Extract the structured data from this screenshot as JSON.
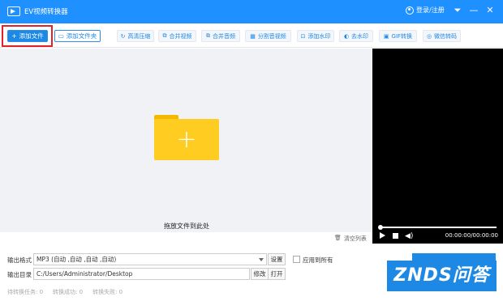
{
  "app": {
    "title": "EV视频转换器",
    "user_label": "登录/注册"
  },
  "window": {
    "menu": "⏷",
    "minimize": "—",
    "close": "✕"
  },
  "toolbar": {
    "add_file": "添加文件",
    "add_folder": "添加文件夹",
    "tools": [
      {
        "label": "高清压缩",
        "icon": "↻"
      },
      {
        "label": "合并视频",
        "icon": "⧉"
      },
      {
        "label": "合并音频",
        "icon": "⧉"
      },
      {
        "label": "分割音视频",
        "icon": "▦"
      },
      {
        "label": "添加水印",
        "icon": "⊡"
      },
      {
        "label": "去水印",
        "icon": "◐"
      },
      {
        "label": "GIF转换",
        "icon": "▣"
      },
      {
        "label": "微信转码",
        "icon": "◎"
      }
    ]
  },
  "dropzone": {
    "text": "拖放文件到此处"
  },
  "player": {
    "time": "00:00:00/00:00:00"
  },
  "list": {
    "clear_label": "清空列表"
  },
  "output": {
    "format_label": "输出格式",
    "format_value": "MP3 (自动 ,自动 ,自动 ,自动)",
    "settings_label": "设置",
    "apply_all_label": "应用到所有",
    "dir_label": "输出目录",
    "dir_value": "C:/Users/Administrator/Desktop",
    "modify_label": "修改",
    "open_label": "打开"
  },
  "stats": {
    "waiting": "待转换任务: 0",
    "success": "转换成功: 0",
    "failed": "转换失败: 0"
  },
  "watermark": {
    "text": "ZNDS问答"
  },
  "colors": {
    "accent": "#1e88e5",
    "highlight": "#e5202a",
    "folder": "#ffcd22"
  }
}
